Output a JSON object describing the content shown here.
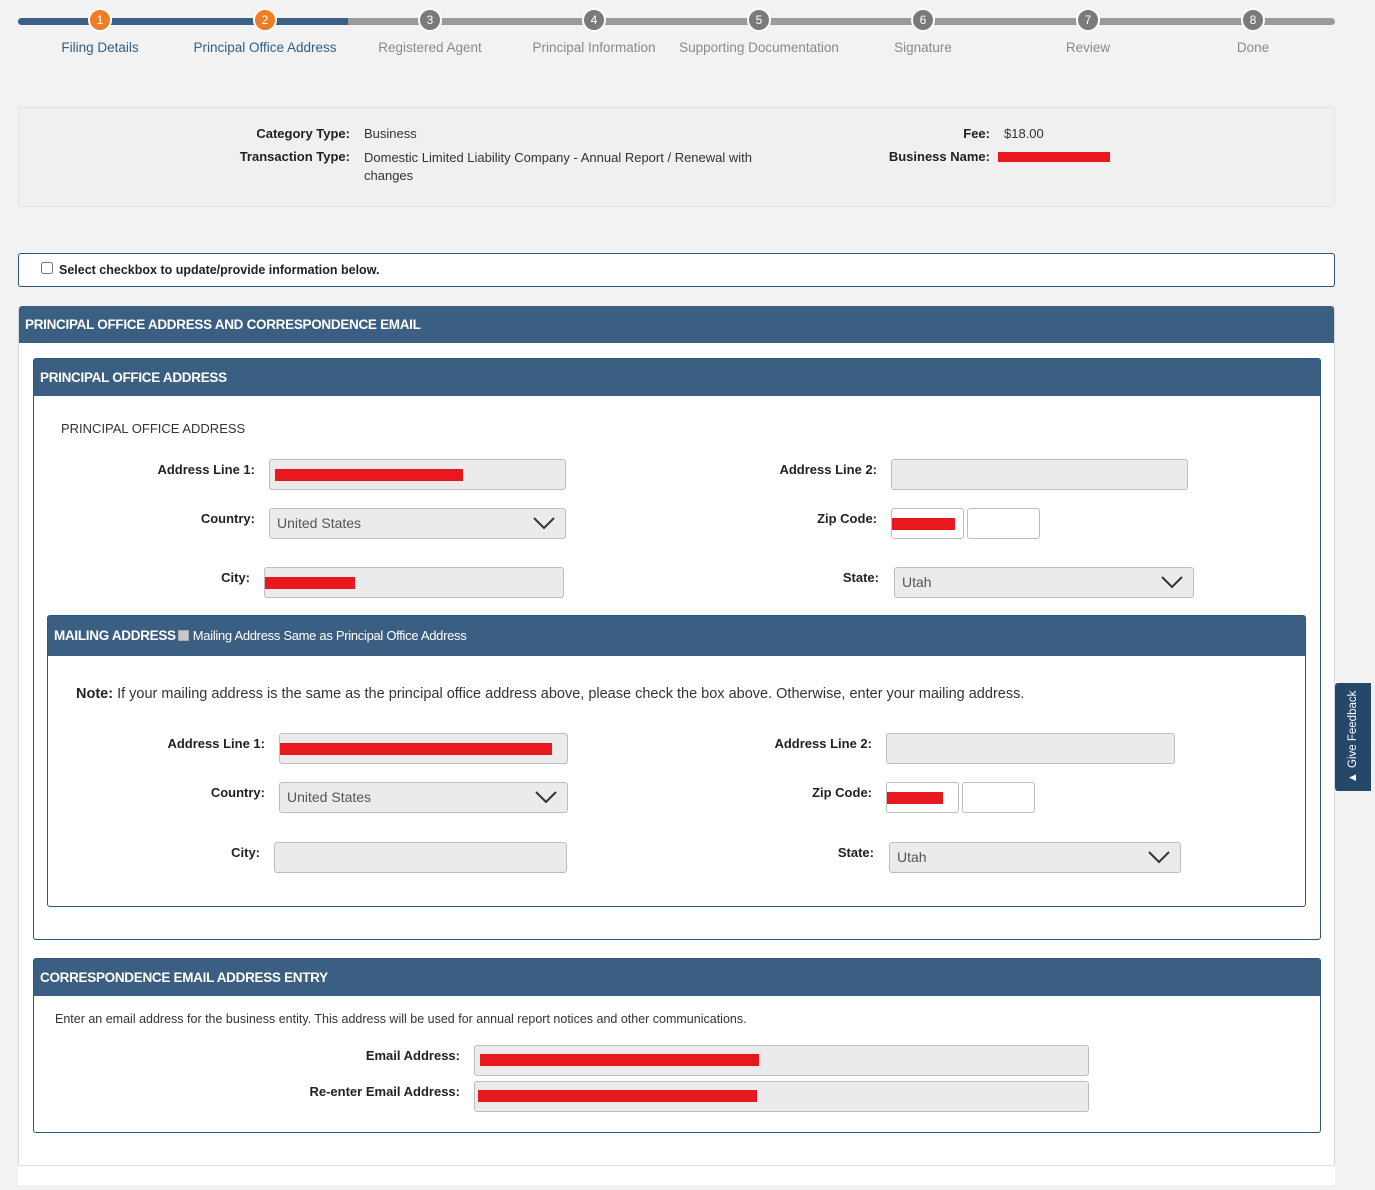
{
  "stepper": {
    "steps": [
      {
        "num": "1",
        "label": "Filing Details",
        "state": "done"
      },
      {
        "num": "2",
        "label": "Principal Office Address",
        "state": "current"
      },
      {
        "num": "3",
        "label": "Registered Agent",
        "state": "todo"
      },
      {
        "num": "4",
        "label": "Principal Information",
        "state": "todo"
      },
      {
        "num": "5",
        "label": "Supporting Documentation",
        "state": "todo"
      },
      {
        "num": "6",
        "label": "Signature",
        "state": "todo"
      },
      {
        "num": "7",
        "label": "Review",
        "state": "todo"
      },
      {
        "num": "8",
        "label": "Done",
        "state": "todo"
      }
    ],
    "colors": {
      "done": "#f07c23",
      "todo": "#7a7a7a",
      "track_done": "#3b5f82"
    }
  },
  "summary": {
    "category_type_label": "Category Type:",
    "category_type_value": "Business",
    "transaction_type_label": "Transaction Type:",
    "transaction_type_value": "Domestic Limited Liability Company - Annual Report / Renewal with changes",
    "fee_label": "Fee:",
    "fee_value": "$18.00",
    "business_name_label": "Business Name:"
  },
  "update_checkbox": {
    "label": "Select checkbox to update/provide information below.",
    "checked": false
  },
  "main_panel": {
    "title": "PRINCIPAL OFFICE ADDRESS AND CORRESPONDENCE EMAIL"
  },
  "principal_office": {
    "panel_title": "PRINCIPAL OFFICE ADDRESS",
    "sub_title": "PRINCIPAL OFFICE ADDRESS",
    "address_line1_label": "Address Line 1:",
    "address_line2_label": "Address Line 2:",
    "country_label": "Country:",
    "country_value": "United States",
    "zip_label": "Zip Code:",
    "city_label": "City:",
    "state_label": "State:",
    "state_value": "Utah"
  },
  "mailing": {
    "panel_title": "MAILING ADDRESS",
    "same_checkbox_label": "Mailing Address Same as Principal Office Address",
    "note_bold": "Note:",
    "note_text": " If your mailing address is the same as the principal office address above, please check the box above. Otherwise, enter your mailing address.",
    "address_line1_label": "Address Line 1:",
    "address_line2_label": "Address Line 2:",
    "country_label": "Country:",
    "country_value": "United States",
    "zip_label": "Zip Code:",
    "city_label": "City:",
    "state_label": "State:",
    "state_value": "Utah"
  },
  "email": {
    "panel_title": "CORRESPONDENCE EMAIL ADDRESS ENTRY",
    "info": "Enter an email address for the business entity. This address will be used for annual report notices and other communications.",
    "email_label": "Email Address:",
    "reenter_label": "Re-enter Email Address:"
  },
  "feedback": {
    "label": "Give Feedback",
    "icon": "megaphone-icon"
  },
  "colors": {
    "header_blue": "#3b5f82",
    "redaction_red": "#e8191e",
    "accent_orange": "#f07c23"
  }
}
